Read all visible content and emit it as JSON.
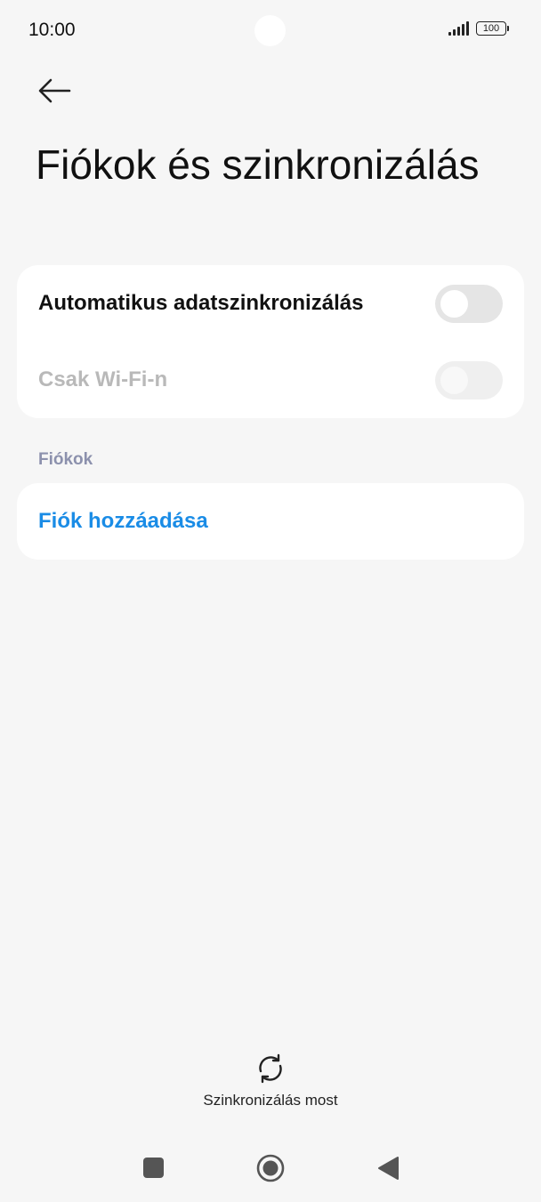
{
  "status_bar": {
    "time": "10:00",
    "battery": "100",
    "icons": [
      "signal-icon",
      "battery-icon"
    ]
  },
  "header": {
    "back_icon": "arrow-left-icon",
    "title": "Fiókok és szinkronizálás"
  },
  "sync_settings": {
    "auto_sync": {
      "label": "Automatikus adatszinkronizálás",
      "enabled": false
    },
    "wifi_only": {
      "label": "Csak Wi-Fi-n",
      "enabled": false,
      "disabled": true
    }
  },
  "accounts": {
    "section_label": "Fiókok",
    "add_account_label": "Fiók hozzáadása"
  },
  "actions": {
    "sync_now_label": "Szinkronizálás most",
    "sync_icon": "sync-icon"
  },
  "nav_bar": {
    "icons": [
      "recent-apps-icon",
      "home-icon",
      "back-icon"
    ]
  },
  "colors": {
    "accent": "#1a8ce6",
    "section_label": "#8c91ad",
    "background": "#f6f6f6"
  }
}
